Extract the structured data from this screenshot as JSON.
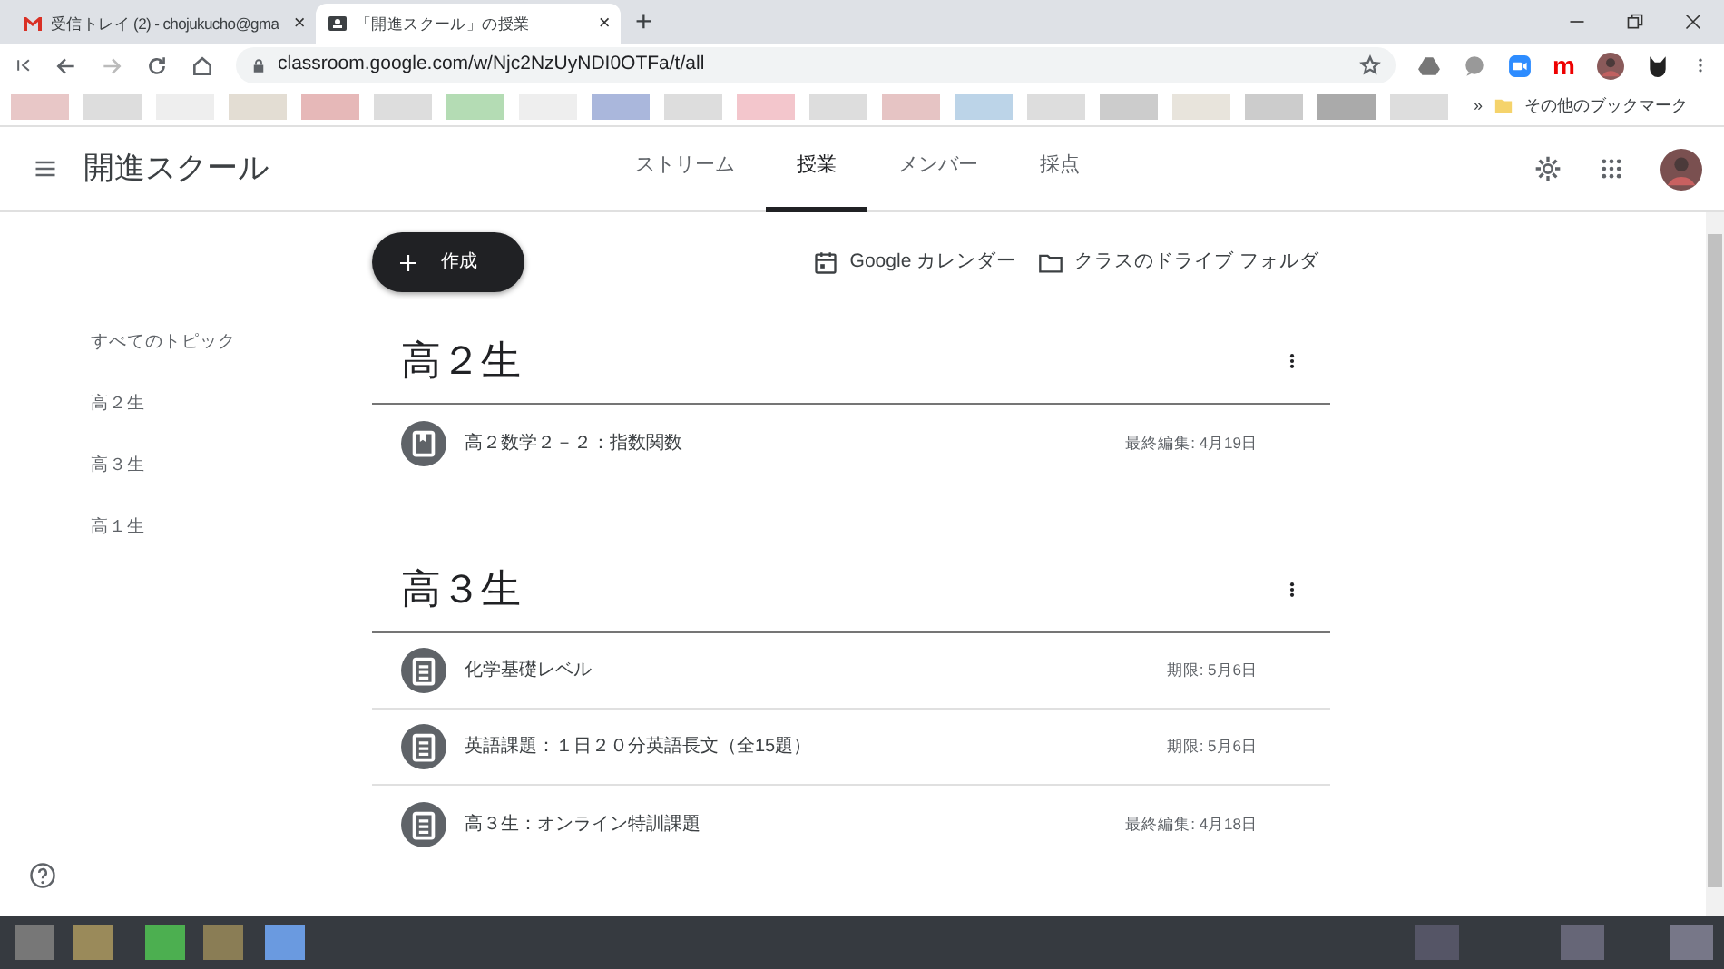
{
  "browser": {
    "tabs": [
      {
        "title": "受信トレイ (2) - chojukucho@gma",
        "close": "×",
        "selected": false,
        "kind": "mail"
      },
      {
        "title": "「開進スクール」の授業",
        "close": "×",
        "selected": true,
        "kind": "classroom"
      }
    ],
    "new_tab": "+",
    "address": "classroom.google.com/w/Njc2NzUyNDI0OTFa/t/all",
    "extension_label": "m",
    "bookmarks_more": "»",
    "bookmarks_other": "その他のブックマーク"
  },
  "app": {
    "title": "開進スクール",
    "nav": [
      {
        "label": "ストリーム",
        "selected": false
      },
      {
        "label": "授業",
        "selected": true
      },
      {
        "label": "メンバー",
        "selected": false
      },
      {
        "label": "採点",
        "selected": false
      }
    ],
    "create_button": "作成",
    "links": [
      {
        "label": "Google カレンダー",
        "kind": "calendar"
      },
      {
        "label": "クラスのドライブ フォルダ",
        "kind": "folder"
      }
    ],
    "topics": [
      {
        "label": "すべてのトピック"
      },
      {
        "label": "高２生"
      },
      {
        "label": "高３生"
      },
      {
        "label": "高１生"
      }
    ],
    "sections": [
      {
        "title": "高２生",
        "items": [
          {
            "title": "高２数学２－２：指数関数",
            "meta": "最終編集: 4月19日",
            "kind": "material"
          }
        ]
      },
      {
        "title": "高３生",
        "items": [
          {
            "title": "化学基礎レベル",
            "meta": "期限: 5月6日",
            "kind": "assignment"
          },
          {
            "title": "英語課題：１日２０分英語長文（全15題）",
            "meta": "期限: 5月6日",
            "kind": "assignment"
          },
          {
            "title": "高３生：オンライン特訓課題",
            "meta": "最終編集: 4月18日",
            "kind": "assignment"
          }
        ]
      }
    ]
  }
}
